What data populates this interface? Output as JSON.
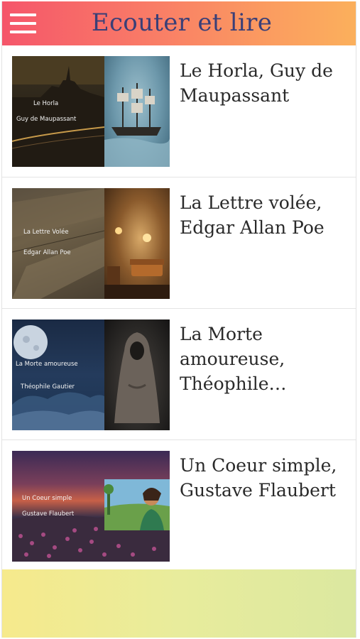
{
  "header": {
    "title": "Ecouter et lire",
    "menu_icon": "hamburger-menu-icon",
    "gradient": [
      "#f5566a",
      "#fbb05c"
    ],
    "title_color": "#3a3f77"
  },
  "stories": [
    {
      "title": "Le Horla, Guy de Maupassant",
      "thumb_line1": "Le Horla",
      "thumb_line2": "Guy de Maupassant"
    },
    {
      "title": "La Lettre volée, Edgar Allan Poe",
      "thumb_line1": "La Lettre Volée",
      "thumb_line2": "Edgar Allan Poe"
    },
    {
      "title": "La Morte amoureuse, Théophile…",
      "thumb_line1": "La Morte amoureuse",
      "thumb_line2": "Théophile Gautier"
    },
    {
      "title": "Un Coeur simple, Gustave Flaubert",
      "thumb_line1": "Un Coeur simple",
      "thumb_line2": "Gustave Flaubert"
    }
  ],
  "footer": {
    "gradient": [
      "#f6ea8c",
      "#dbe8a0"
    ]
  }
}
